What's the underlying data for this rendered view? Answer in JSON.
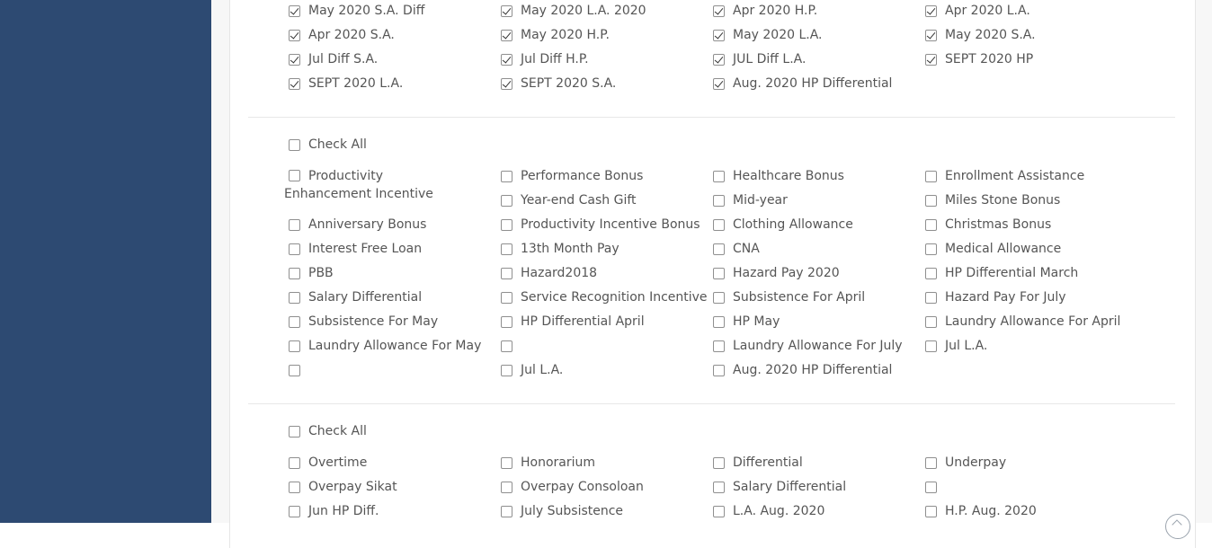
{
  "section_a": {
    "items": [
      {
        "label": "May 2020 S.A. Diff",
        "checked": true
      },
      {
        "label": "May 2020 L.A. 2020",
        "checked": true
      },
      {
        "label": "Apr 2020 H.P.",
        "checked": true
      },
      {
        "label": "Apr 2020 L.A.",
        "checked": true
      },
      {
        "label": "Apr 2020 S.A.",
        "checked": true
      },
      {
        "label": "May 2020 H.P.",
        "checked": true
      },
      {
        "label": "May 2020 L.A.",
        "checked": true
      },
      {
        "label": "May 2020 S.A.",
        "checked": true
      },
      {
        "label": "Jul Diff S.A.",
        "checked": true
      },
      {
        "label": "Jul Diff H.P.",
        "checked": true
      },
      {
        "label": "JUL Diff L.A.",
        "checked": true
      },
      {
        "label": "SEPT 2020 HP",
        "checked": true
      },
      {
        "label": "SEPT 2020 L.A.",
        "checked": true
      },
      {
        "label": "SEPT 2020 S.A.",
        "checked": true
      },
      {
        "label": "Aug. 2020 HP Differential",
        "checked": true
      }
    ]
  },
  "section_b": {
    "check_all_label": "Check All",
    "wrapped_item": {
      "label": "Productivity Enhancement Incentive",
      "checked": false
    },
    "items": [
      {
        "label": "Performance Bonus",
        "checked": false
      },
      {
        "label": "Healthcare Bonus",
        "checked": false
      },
      {
        "label": "Enrollment Assistance",
        "checked": false
      },
      {
        "label": "Year-end Cash Gift",
        "checked": false
      },
      {
        "label": "Mid-year",
        "checked": false
      },
      {
        "label": "Miles Stone Bonus",
        "checked": false
      },
      {
        "label": "Anniversary Bonus",
        "checked": false
      },
      {
        "label": "Productivity Incentive Bonus",
        "checked": false
      },
      {
        "label": "Clothing Allowance",
        "checked": false
      },
      {
        "label": "Christmas Bonus",
        "checked": false
      },
      {
        "label": "Interest Free Loan",
        "checked": false
      },
      {
        "label": "13th Month Pay",
        "checked": false
      },
      {
        "label": "CNA",
        "checked": false
      },
      {
        "label": "Medical Allowance",
        "checked": false
      },
      {
        "label": "PBB",
        "checked": false
      },
      {
        "label": "Hazard2018",
        "checked": false
      },
      {
        "label": "Hazard Pay 2020",
        "checked": false
      },
      {
        "label": "HP Differential March",
        "checked": false
      },
      {
        "label": "Salary Differential",
        "checked": false
      },
      {
        "label": "Service Recognition Incentive",
        "checked": false
      },
      {
        "label": "Subsistence For April",
        "checked": false
      },
      {
        "label": "Hazard Pay For July",
        "checked": false
      },
      {
        "label": "Subsistence For May",
        "checked": false
      },
      {
        "label": "HP Differential April",
        "checked": false
      },
      {
        "label": "HP May",
        "checked": false
      },
      {
        "label": "Laundry Allowance For April",
        "checked": false
      },
      {
        "label": "Laundry Allowance For May",
        "checked": false
      },
      {
        "label": "",
        "checked": false
      },
      {
        "label": "Laundry Allowance For July",
        "checked": false
      },
      {
        "label": "Jul L.A.",
        "checked": false
      },
      {
        "label": "",
        "checked": false
      },
      {
        "label": "Jul L.A.",
        "checked": false
      },
      {
        "label": "Aug. 2020 HP Differential",
        "checked": false
      }
    ]
  },
  "section_c": {
    "check_all_label": "Check All",
    "items": [
      {
        "label": "Overtime",
        "checked": false
      },
      {
        "label": "Honorarium",
        "checked": false
      },
      {
        "label": "Differential",
        "checked": false
      },
      {
        "label": "Underpay",
        "checked": false
      },
      {
        "label": "Overpay Sikat",
        "checked": false
      },
      {
        "label": "Overpay Consoloan",
        "checked": false
      },
      {
        "label": "Salary Differential",
        "checked": false
      },
      {
        "label": "",
        "checked": false
      },
      {
        "label": "Jun HP Diff.",
        "checked": false
      },
      {
        "label": "July Subsistence",
        "checked": false
      },
      {
        "label": "L.A. Aug. 2020",
        "checked": false
      },
      {
        "label": "H.P. Aug. 2020",
        "checked": false
      }
    ]
  },
  "icons": {
    "corner": "scroll-top-icon"
  }
}
